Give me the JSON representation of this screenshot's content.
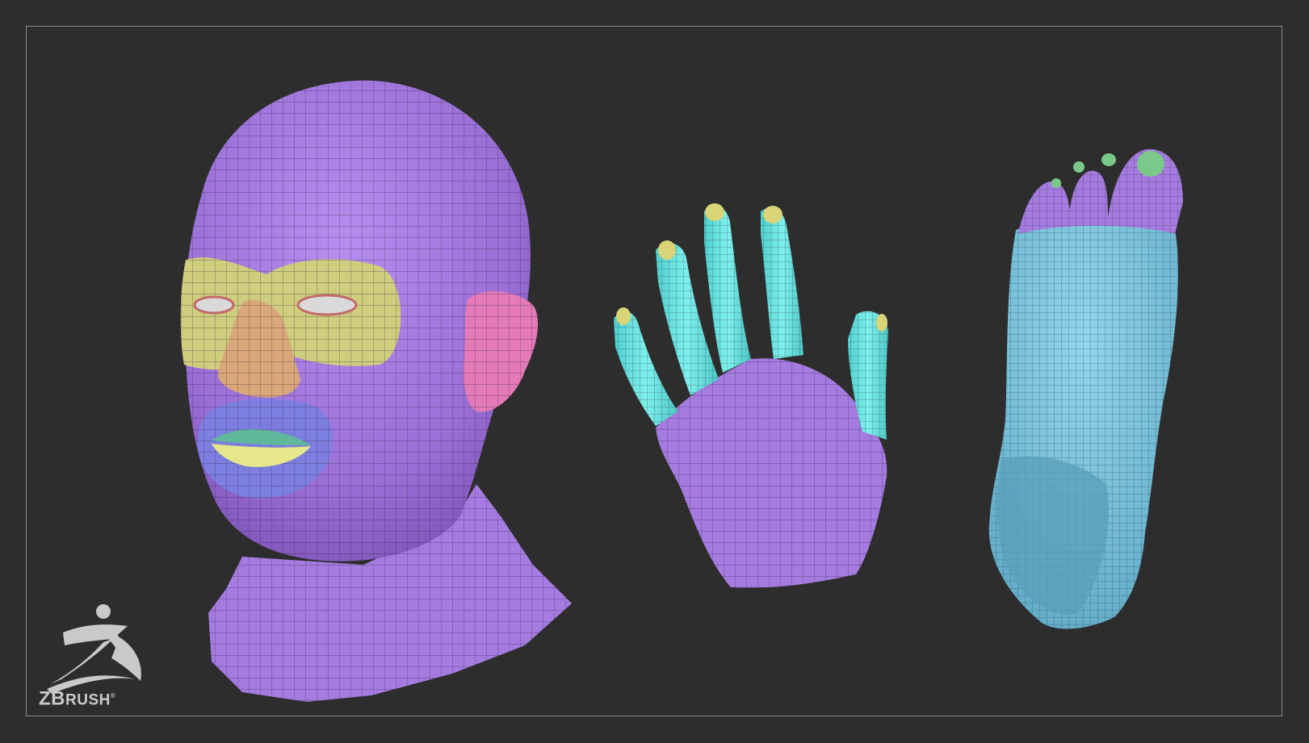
{
  "logo": {
    "text_big": "ZB",
    "text_small": "RUSH",
    "reg": "®"
  },
  "colors": {
    "background": "#2d2d2d",
    "frame": "#8a8a8a",
    "skin_purple": "#a57be0",
    "eye_yellow": "#cfcd7e",
    "nose_orange": "#d9a77a",
    "mouth_blue": "#7d7fe0",
    "lip_yellow": "#e6e68a",
    "lip_green": "#5fb89b",
    "ear_pink": "#e47ab8",
    "finger_cyan": "#6ee6e6",
    "nail_yellow": "#d8d477",
    "foot_blue": "#82c8e0",
    "toenail_green": "#7bc88b",
    "logo_gray": "#c9c9c9"
  },
  "models": {
    "head": "head-mesh",
    "hand": "hand-mesh",
    "foot": "foot-mesh"
  }
}
